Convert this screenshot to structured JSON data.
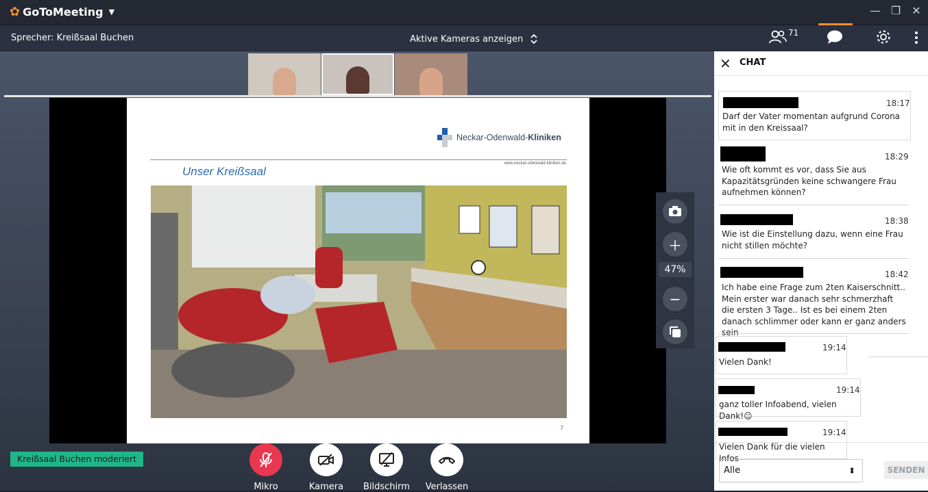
{
  "app": {
    "name": "GoToMeeting",
    "logo_icon": "orange-flower"
  },
  "toolbar": {
    "speaker": "Sprecher: Kreißsaal Buchen",
    "cameras_toggle": "Aktive Kameras anzeigen",
    "participant_count": "71"
  },
  "slide": {
    "brand_plain": "Neckar-Odenwald-",
    "brand_bold": "Kliniken",
    "url": "www.neckar-odenwald-kliniken.de",
    "title": "Unser Kreißsaal",
    "page": "7"
  },
  "zoom": {
    "value": "47%"
  },
  "moderator_badge": "Kreißsaal Buchen moderiert",
  "controls": {
    "mic": "Mikro",
    "camera": "Kamera",
    "screen": "Bildschirm",
    "leave": "Verlassen"
  },
  "chat": {
    "title": "CHAT",
    "messages": [
      {
        "time": "18:17",
        "text": "Darf der Vater momentan aufgrund Corona mit in den Kreissaal?"
      },
      {
        "time": "18:29",
        "text": "Wie oft kommt es vor, dass Sie aus Kapazitätsgründen keine schwangere Frau aufnehmen können?"
      },
      {
        "time": "18:38",
        "text": "Wie ist die Einstellung dazu, wenn eine Frau nicht stillen möchte?"
      },
      {
        "time": "18:42",
        "text": "Ich habe eine Frage zum 2ten Kaiserschnitt.. Mein erster war danach sehr schmerzhaft die ersten 3 Tage.. Ist es bei einem 2ten danach schlimmer oder kann er ganz anders sein"
      },
      {
        "time": "19:14",
        "text": "Vielen Dank!"
      },
      {
        "time": "19:14",
        "text": "ganz toller Infoabend, vielen Dank!☺"
      },
      {
        "time": "19:14",
        "text": "Vielen Dank für die vielen Infos"
      }
    ],
    "recipient": "Alle",
    "send": "SENDEN"
  },
  "colors": {
    "accent": "#f68d2e",
    "mic_active": "#e8374f",
    "moderator": "#1fb78a"
  }
}
